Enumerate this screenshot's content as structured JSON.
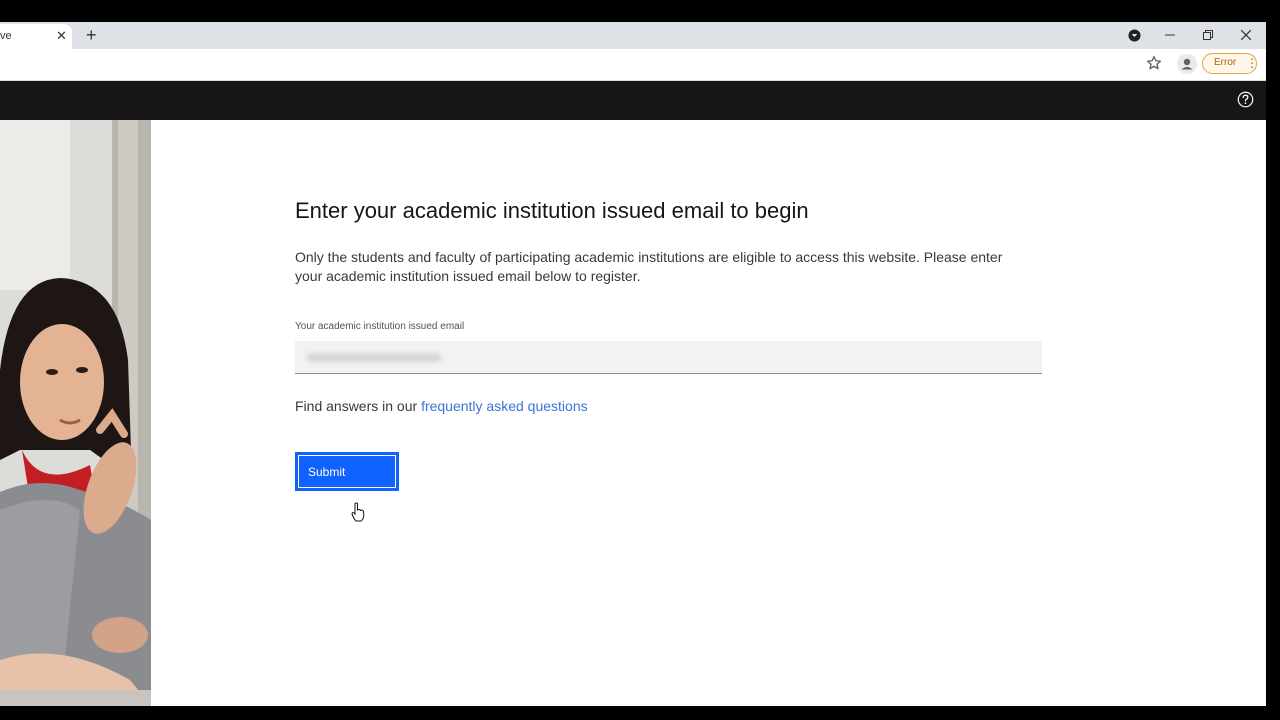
{
  "browser": {
    "tab_title_fragment": "ve",
    "tab_close_glyph": "✕",
    "new_tab_glyph": "+",
    "error_label": "Error",
    "menu_glyph": "⋮"
  },
  "main": {
    "heading": "Enter your academic institution issued email to begin",
    "description": "Only the students and faculty of participating academic institutions are eligible to access this website. Please enter your academic institution issued email below to register.",
    "email_label": "Your academic institution issued email",
    "faq_prefix": "Find answers in our ",
    "faq_link": "frequently asked questions",
    "submit_label": "Submit"
  },
  "colors": {
    "primary": "#0f62fe",
    "link": "#3b73d8",
    "header": "#161616"
  }
}
